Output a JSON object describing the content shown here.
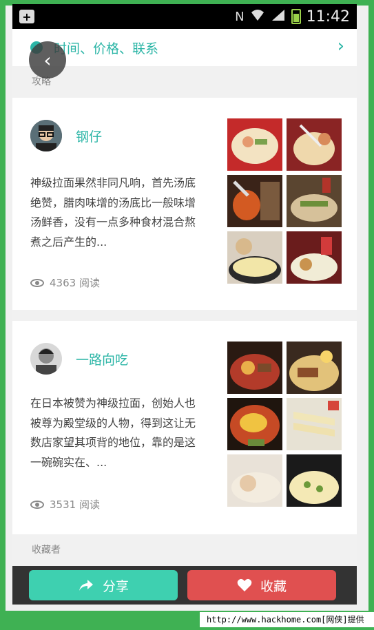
{
  "status_bar": {
    "time": "11:42"
  },
  "header": {
    "title": "时间、价格、联系"
  },
  "sections": {
    "strategy_label": "攻略",
    "collectors_label": "收藏者"
  },
  "posts": [
    {
      "author": "钢仔",
      "description": "神级拉面果然非同凡响，首先汤底绝赞，腊肉味增的汤底比一般味增汤鲜香，没有一点多种食材混合熬煮之后产生的...",
      "reads": "4363 阅读"
    },
    {
      "author": "一路向吃",
      "description": "在日本被赞为神级拉面，创始人也被尊为殿堂级的人物，得到这让无数店家望其项背的地位，靠的是这一碗碗实在、...",
      "reads": "3531 阅读"
    }
  ],
  "actions": {
    "share_label": "分享",
    "favorite_label": "收藏"
  },
  "watermark": "http://www.hackhome.com[网侠]提供",
  "colors": {
    "accent": "#2bb5a6",
    "share": "#3ed0b0",
    "favorite": "#e05050",
    "frame": "#3fb153"
  }
}
